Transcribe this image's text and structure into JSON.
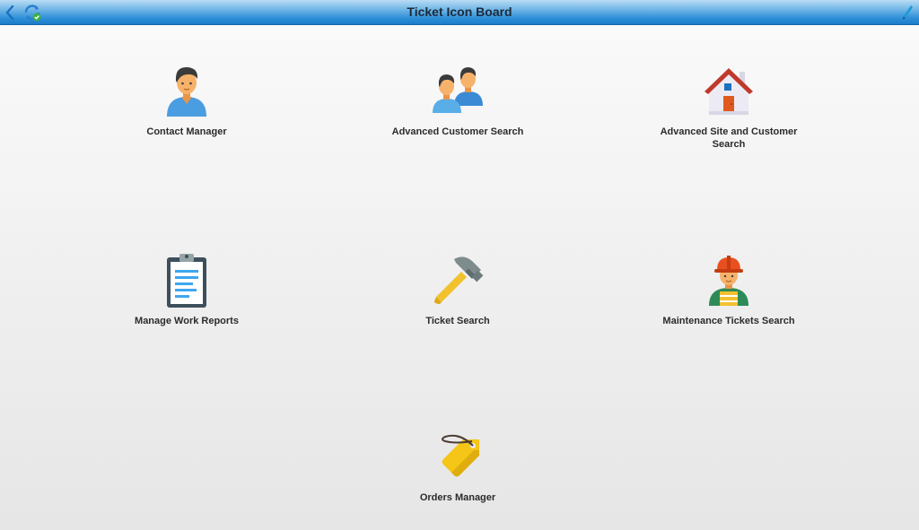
{
  "window": {
    "title": "Ticket Icon Board"
  },
  "toolbar": {
    "back_icon": "chevron-left-icon",
    "refresh_icon": "refresh-check-icon",
    "edit_icon": "pencil-icon"
  },
  "tiles": [
    {
      "label": "Contact Manager",
      "icon": "person-icon"
    },
    {
      "label": "Advanced Customer Search",
      "icon": "people-icon"
    },
    {
      "label": "Advanced Site and Customer Search",
      "icon": "house-icon"
    },
    {
      "label": "Manage Work Reports",
      "icon": "clipboard-icon"
    },
    {
      "label": "Ticket Search",
      "icon": "hammer-icon"
    },
    {
      "label": "Maintenance Tickets Search",
      "icon": "worker-icon"
    },
    {
      "label": "Orders Manager",
      "icon": "tag-icon"
    }
  ],
  "colors": {
    "titlebar": "#2e8fd8",
    "skin": "#f6b26b",
    "shirt_blue": "#4a9de0",
    "hair": "#3b3b3b",
    "hammer_handle": "#f2c12e",
    "hammer_head": "#7f8c8d",
    "house_roof": "#c0392b",
    "house_door": "#e05a20",
    "tag": "#f5c518",
    "helmet": "#e8501f",
    "vest": "#2e8b57"
  }
}
